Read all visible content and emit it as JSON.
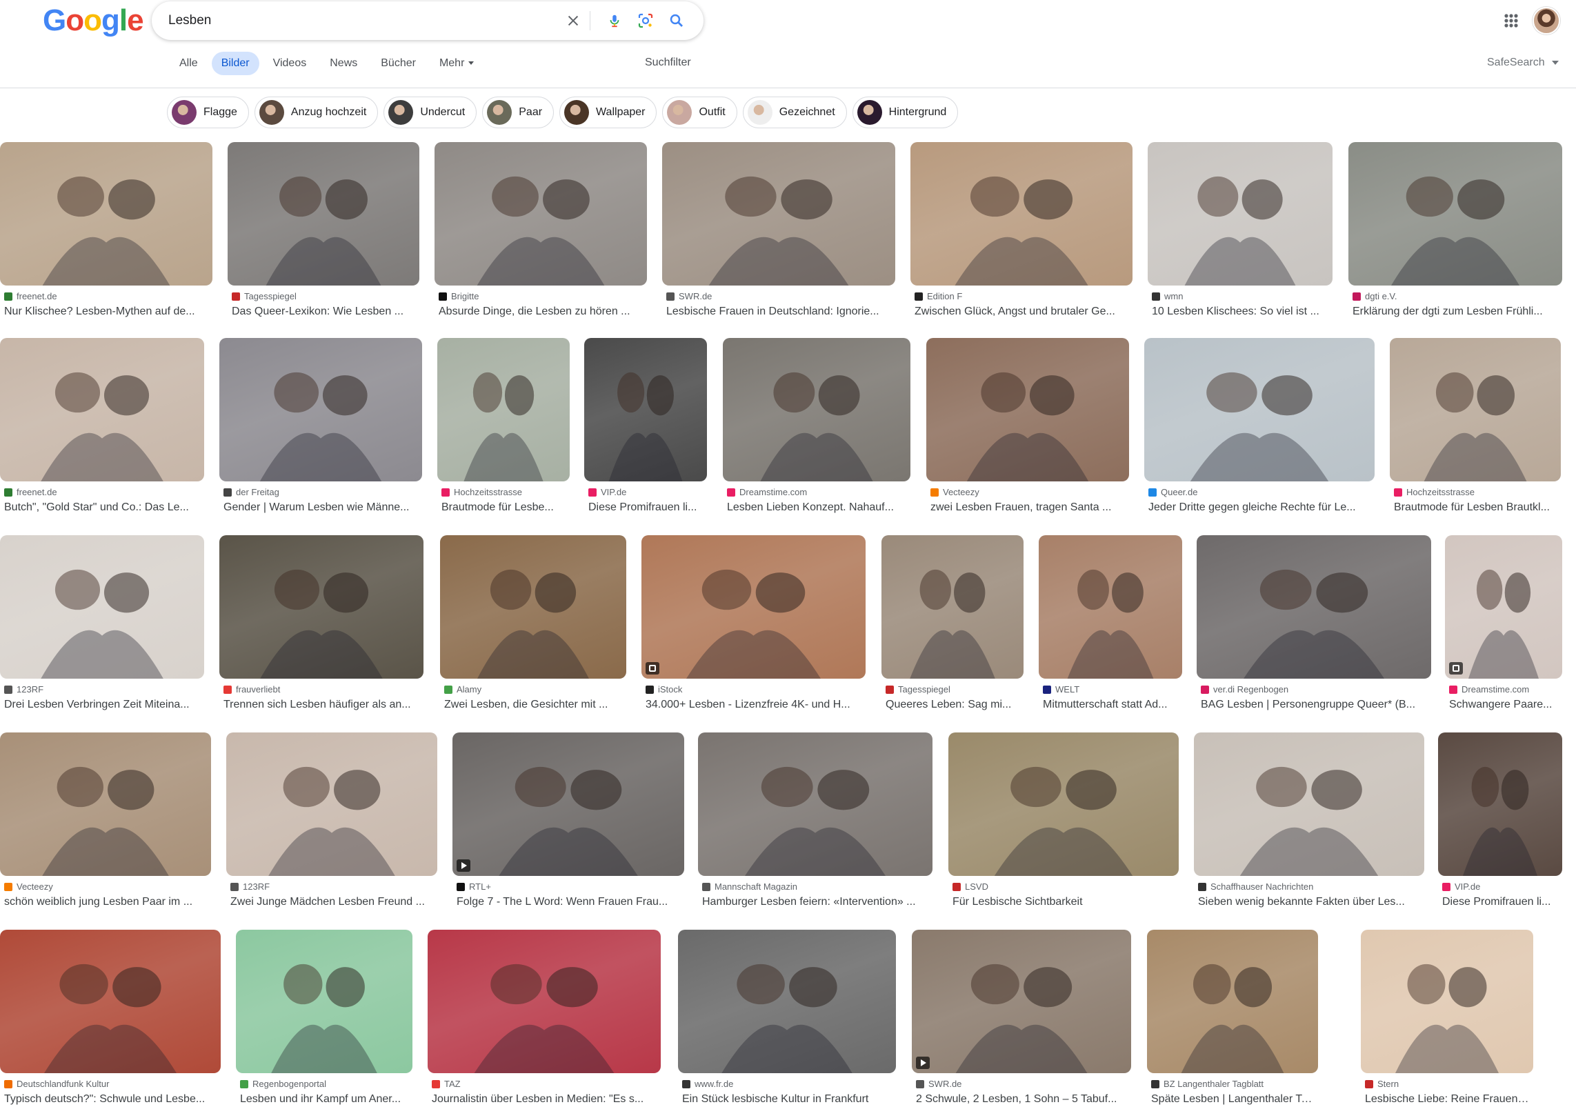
{
  "search": {
    "query": "Lesben"
  },
  "logo": {
    "letters": [
      "G",
      "o",
      "o",
      "g",
      "l",
      "e"
    ],
    "colors": [
      "#4285f4",
      "#ea4335",
      "#fbbc05",
      "#4285f4",
      "#34a853",
      "#ea4335"
    ]
  },
  "tabs": [
    {
      "label": "Alle",
      "active": false
    },
    {
      "label": "Bilder",
      "active": true
    },
    {
      "label": "Videos",
      "active": false
    },
    {
      "label": "News",
      "active": false
    },
    {
      "label": "Bücher",
      "active": false
    },
    {
      "label": "Mehr",
      "active": false
    }
  ],
  "suchfilter_label": "Suchfilter",
  "safesearch_label": "SafeSearch",
  "chips": [
    {
      "label": "Flagge",
      "color": "#7a3b6e"
    },
    {
      "label": "Anzug hochzeit",
      "color": "#5b4a3f"
    },
    {
      "label": "Undercut",
      "color": "#3d3d3d"
    },
    {
      "label": "Paar",
      "color": "#6a6a5a"
    },
    {
      "label": "Wallpaper",
      "color": "#4a3526"
    },
    {
      "label": "Outfit",
      "color": "#c9a8a0"
    },
    {
      "label": "Gezeichnet",
      "color": "#eeeeee"
    },
    {
      "label": "Hintergrund",
      "color": "#2a1a2e"
    }
  ],
  "results": [
    {
      "source": "freenet.de",
      "title": "Nur Klischee? Lesben-Mythen auf de...",
      "fav": "#2e7d32",
      "bg": "#b9a48c"
    },
    {
      "source": "Tagesspiegel",
      "title": "Das Queer-Lexikon: Wie Lesben ...",
      "fav": "#c62828",
      "bg": "#7d7a78"
    },
    {
      "source": "Brigitte",
      "title": "Absurde Dinge, die Lesben zu hören ...",
      "fav": "#111111",
      "bg": "#8f8a86"
    },
    {
      "source": "SWR.de",
      "title": "Lesbische Frauen in Deutschland: Ignorie...",
      "fav": "#555555",
      "bg": "#9c8f83"
    },
    {
      "source": "Edition F",
      "title": "Zwischen Glück, Angst und brutaler Ge...",
      "fav": "#222222",
      "bg": "#b89a7e"
    },
    {
      "source": "wmn",
      "title": "10 Lesben Klischees: So viel ist ...",
      "fav": "#333333",
      "bg": "#c8c4c0"
    },
    {
      "source": "dgti e.V.",
      "title": "Erklärung der dgti zum Lesben Frühli...",
      "fav": "#c2185b",
      "bg": "#8a8d86"
    },
    {
      "source": "freenet.de",
      "title": "Butch\", \"Gold Star\" und Co.: Das Le...",
      "fav": "#2e7d32",
      "bg": "#c7b6a8"
    },
    {
      "source": "der Freitag",
      "title": "Gender | Warum Lesben wie Männe...",
      "fav": "#444444",
      "bg": "#8c8a90"
    },
    {
      "source": "Hochzeitsstrasse",
      "title": "Brautmode für Lesbe...",
      "fav": "#e91e63",
      "bg": "#a7b0a3"
    },
    {
      "source": "VIP.de",
      "title": "Diese Promifrauen li...",
      "fav": "#e91e63",
      "bg": "#4a4a4a"
    },
    {
      "source": "Dreamstime.com",
      "title": "Lesben Lieben Konzept. Nahauf...",
      "fav": "#e91e63",
      "bg": "#7a7670"
    },
    {
      "source": "Vecteezy",
      "title": "zwei Lesben Frauen, tragen Santa ...",
      "fav": "#f57c00",
      "bg": "#8d6e5c"
    },
    {
      "source": "Queer.de",
      "title": "Jeder Dritte gegen gleiche Rechte für Le...",
      "fav": "#1e88e5",
      "bg": "#b9c2c8"
    },
    {
      "source": "Hochzeitsstrasse",
      "title": "Brautmode für Lesben Brautkl...",
      "fav": "#e91e63",
      "bg": "#b8a898"
    },
    {
      "source": "123RF",
      "title": "Drei Lesben Verbringen Zeit Miteina...",
      "fav": "#555555",
      "bg": "#d8d2cc"
    },
    {
      "source": "frauverliebt",
      "title": "Trennen sich Lesben häufiger als an...",
      "fav": "#e53935",
      "bg": "#5a5448"
    },
    {
      "source": "Alamy",
      "title": "Zwei Lesben, die Gesichter mit ...",
      "fav": "#43a047",
      "bg": "#8a6a4a"
    },
    {
      "source": "iStock",
      "title": "34.000+ Lesben - Lizenzfreie 4K- und H...",
      "fav": "#222222",
      "bg": "#b07858"
    },
    {
      "source": "Tagesspiegel",
      "title": "Queeres Leben: Sag mi...",
      "fav": "#c62828",
      "bg": "#9a8a7a"
    },
    {
      "source": "WELT",
      "title": "Mitmutterschaft statt Ad...",
      "fav": "#1a237e",
      "bg": "#a88068"
    },
    {
      "source": "ver.di Regenbogen",
      "title": "BAG Lesben | Personengruppe Queer* (B...",
      "fav": "#d81b60",
      "bg": "#6e6a6a"
    },
    {
      "source": "Dreamstime.com",
      "title": "Schwangere Paare...",
      "fav": "#e91e63",
      "bg": "#d2c6c0"
    },
    {
      "source": "Vecteezy",
      "title": "schön weiblich jung Lesben Paar im ...",
      "fav": "#f57c00",
      "bg": "#a89078"
    },
    {
      "source": "123RF",
      "title": "Zwei Junge Mädchen Lesben Freund ...",
      "fav": "#555555",
      "bg": "#c8b8ac"
    },
    {
      "source": "RTL+",
      "title": "Folge 7 - The L Word: Wenn Frauen Frau...",
      "fav": "#111111",
      "bg": "#6a6664"
    },
    {
      "source": "Mannschaft Magazin",
      "title": "Hamburger Lesben feiern: «Intervention» ...",
      "fav": "#555555",
      "bg": "#7a7470"
    },
    {
      "source": "LSVD",
      "title": "Für Lesbische Sichtbarkeit",
      "fav": "#c62828",
      "bg": "#9a8a6a"
    },
    {
      "source": "Schaffhauser Nachrichten",
      "title": "Sieben wenig bekannte Fakten über Les...",
      "fav": "#333333",
      "bg": "#c8c0b8"
    },
    {
      "source": "VIP.de",
      "title": "Diese Promifrauen li...",
      "fav": "#e91e63",
      "bg": "#5a4a42"
    },
    {
      "source": "Deutschlandfunk Kultur",
      "title": "Typisch deutsch?\": Schwule und Lesbe...",
      "fav": "#ef6c00",
      "bg": "#b04a38"
    },
    {
      "source": "Regenbogenportal",
      "title": "Lesben und ihr Kampf um Aner...",
      "fav": "#43a047",
      "bg": "#8cc8a0"
    },
    {
      "source": "TAZ",
      "title": "Journalistin über Lesben in Medien: \"Es s...",
      "fav": "#e53935",
      "bg": "#b83848"
    },
    {
      "source": "www.fr.de",
      "title": "Ein Stück lesbische Kultur in Frankfurt",
      "fav": "#333333",
      "bg": "#6a6a6a"
    },
    {
      "source": "SWR.de",
      "title": "2 Schwule, 2 Lesben, 1 Sohn – 5 Tabuf...",
      "fav": "#555555",
      "bg": "#8a7a6c"
    },
    {
      "source": "BZ Langenthaler Tagblatt",
      "title": "Späte Lesben | Langenthaler Tagblatt",
      "fav": "#333333",
      "bg": "#a88a68"
    },
    {
      "source": "Stern",
      "title": "Lesbische Liebe: Reine Frauensac...",
      "fav": "#c62828",
      "bg": "#e0c8b0"
    }
  ]
}
